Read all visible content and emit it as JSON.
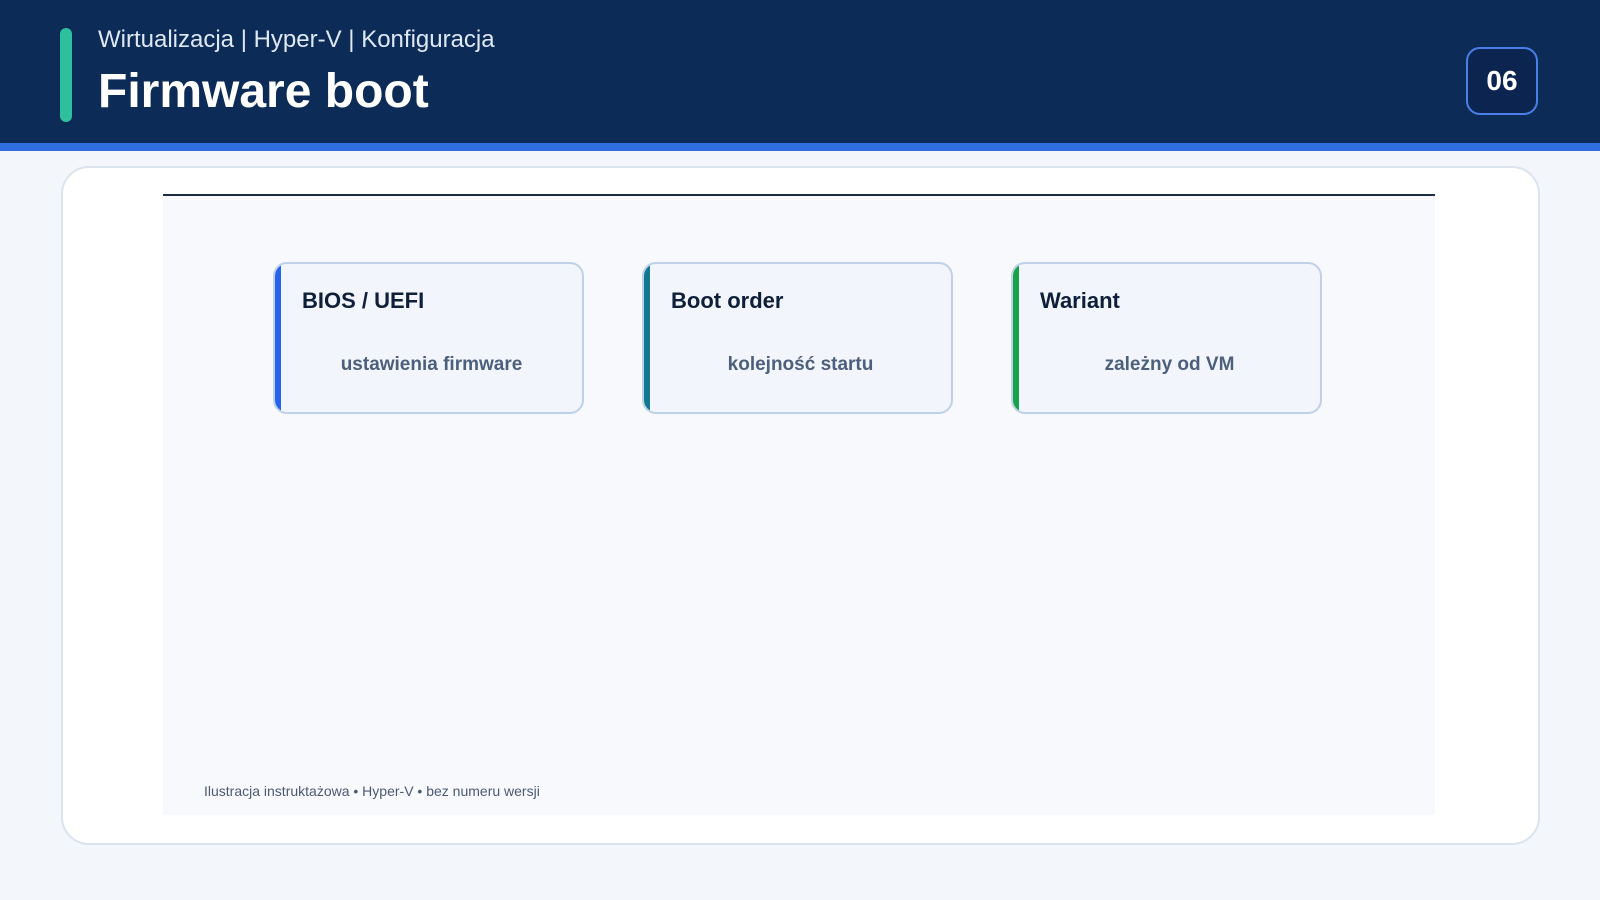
{
  "header": {
    "breadcrumb": "Wirtualizacja | Hyper-V | Konfiguracja",
    "title": "Firmware boot",
    "slide_number": "06"
  },
  "cards": [
    {
      "title": "BIOS / UEFI",
      "subtitle": "ustawienia firmware",
      "accent": "#2563eb"
    },
    {
      "title": "Boot order",
      "subtitle": "kolejność startu",
      "accent": "#12788f"
    },
    {
      "title": "Wariant",
      "subtitle": "zależny od VM",
      "accent": "#16a34a"
    }
  ],
  "footnote": "Ilustracja instruktażowa • Hyper-V • bez numeru wersji",
  "colors": {
    "header_bg": "#0c2c57",
    "header_underline": "#2f6ee0",
    "header_accent": "#2ebf9e",
    "page_bg": "#f3f6fb"
  }
}
